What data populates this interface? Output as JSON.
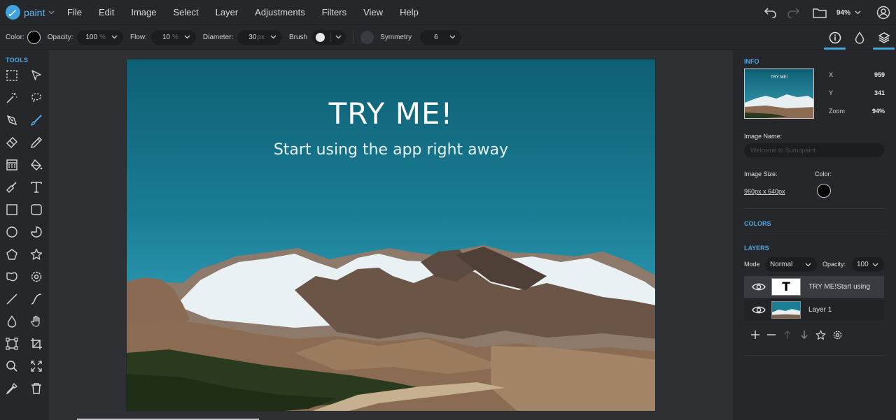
{
  "app": {
    "name": "paint",
    "menu": [
      "File",
      "Edit",
      "Image",
      "Select",
      "Layer",
      "Adjustments",
      "Filters",
      "View",
      "Help"
    ],
    "zoom": "94%"
  },
  "options": {
    "color_label": "Color:",
    "opacity_label": "Opacity:",
    "opacity_value": "100",
    "opacity_unit": "%",
    "flow_label": "Flow:",
    "flow_value": "10",
    "flow_unit": "%",
    "diameter_label": "Diameter:",
    "diameter_value": "30",
    "diameter_unit": "px",
    "brush_label": "Brush",
    "symmetry_label": "Symmetry",
    "symmetry_value": "6",
    "color_value": "#000000"
  },
  "tools": {
    "title": "TOOLS",
    "items": [
      "rect-select",
      "pointer",
      "magic-wand",
      "lasso",
      "pen",
      "brush",
      "eraser",
      "pencil",
      "pattern",
      "fill",
      "clone-stamp",
      "text",
      "rectangle",
      "rounded-rectangle",
      "circle",
      "pie",
      "polygon",
      "star",
      "shape",
      "gear-shape",
      "line",
      "curve",
      "drop",
      "hand",
      "crop-frame",
      "crop",
      "zoom",
      "fit",
      "eyedropper",
      "trash"
    ],
    "active": "brush"
  },
  "canvas": {
    "title": "TRY ME!",
    "subtitle": "Start using the app right away"
  },
  "info": {
    "title": "INFO",
    "thumb_title": "TRY ME!",
    "x_label": "X",
    "x_value": "959",
    "y_label": "Y",
    "y_value": "341",
    "zoom_label": "Zoom",
    "zoom_value": "94%",
    "image_name_label": "Image Name:",
    "image_name_placeholder": "Welcome to Sumopaint",
    "image_size_label": "Image Size:",
    "image_size_value": "960px x 640px",
    "color_label": "Color:",
    "color_value": "#000000"
  },
  "colors": {
    "title": "COLORS"
  },
  "layers": {
    "title": "LAYERS",
    "mode_label": "Mode",
    "mode_value": "Normal",
    "opacity_label": "Opacity:",
    "opacity_value": "100",
    "items": [
      {
        "name": "TRY ME!Start using",
        "thumb": "T",
        "selected": true
      },
      {
        "name": "Layer 1",
        "thumb": "image",
        "selected": false
      }
    ]
  },
  "colors_theme": {
    "accent": "#3fa3de",
    "panel": "#26272b",
    "workspace": "#2f3034"
  }
}
